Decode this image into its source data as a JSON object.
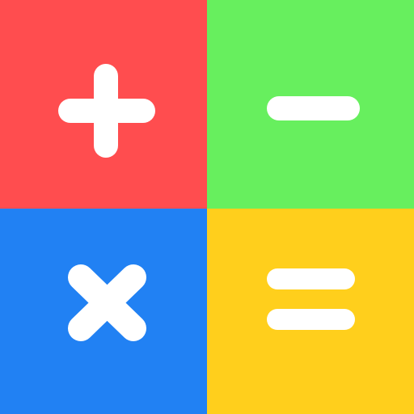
{
  "app_icon": {
    "tiles": [
      {
        "icon": "plus-icon",
        "color": "#ff4d4f"
      },
      {
        "icon": "minus-icon",
        "color": "#67ef5e"
      },
      {
        "icon": "multiply-icon",
        "color": "#2181f3"
      },
      {
        "icon": "equals-icon",
        "color": "#ffcf1c"
      }
    ],
    "glyph_color": "#ffffff"
  }
}
